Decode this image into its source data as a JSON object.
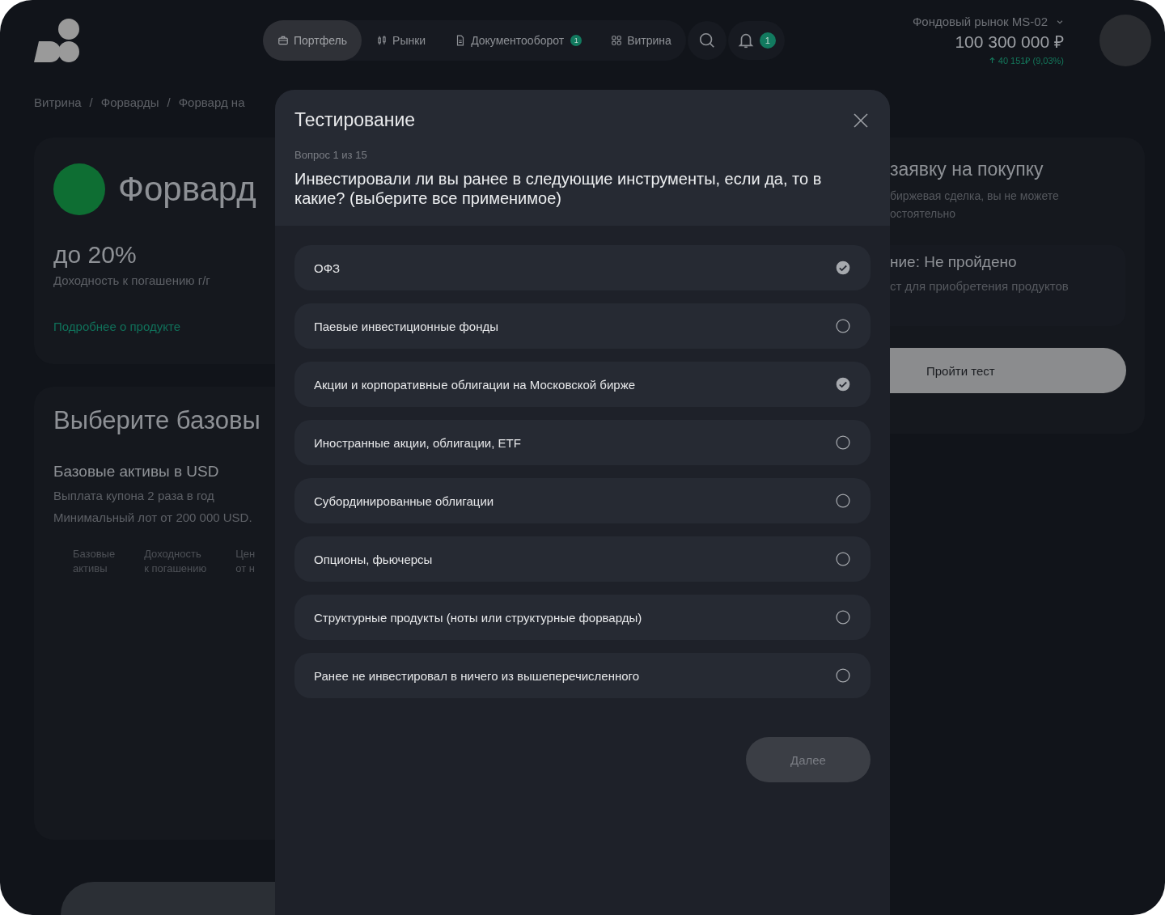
{
  "nav": {
    "tabs": [
      {
        "label": "Портфель",
        "selected": true,
        "kind": "briefcase"
      },
      {
        "label": "Рынки",
        "selected": false,
        "kind": "candles"
      },
      {
        "label": "Документооборот",
        "selected": false,
        "kind": "document",
        "badge": "1"
      },
      {
        "label": "Витрина",
        "selected": false,
        "kind": "grid"
      }
    ],
    "notifications_badge": "1"
  },
  "account": {
    "market": "Фондовый рынок MS-02",
    "balance": "100 300 000 ₽",
    "change": "40 151₽ (9,03%)"
  },
  "breadcrumbs": {
    "separator": "/",
    "items": [
      "Витрина",
      "Форварды",
      "Форвард на"
    ]
  },
  "product_card": {
    "title": "Форвард",
    "yield": "до 20%",
    "yield_label": "Доходность к погашению г/г",
    "link": "Подробнее о продукте"
  },
  "assets_card": {
    "title": "Выберите базовы",
    "group_title": "Базовые активы в USD",
    "notes": [
      "Выплата купона 2 раза в год",
      "Минимальный лот от 200 000 USD."
    ],
    "columns": [
      [
        "Базовые",
        "активы"
      ],
      [
        "Доходность",
        "к погашению"
      ],
      [
        "Цен",
        "от н"
      ]
    ]
  },
  "order_card": {
    "title": "заявку на покупку",
    "text_lines": [
      "биржевая сделка, вы не можете",
      "остоятельно"
    ],
    "status_title": "ние: Не пройдено",
    "status_text": "ст для приобретения продуктов",
    "button": "Пройти тест"
  },
  "quiz": {
    "title": "Тестирование",
    "progress": "Вопрос 1 из 15",
    "question": "Инвестировали ли вы ранее в следующие инструменты, если да, то в какие? (выберите все применимое)",
    "options": [
      {
        "label": "ОФЗ",
        "checked": true
      },
      {
        "label": "Паевые инвестиционные фонды",
        "checked": false
      },
      {
        "label": "Акции и корпоративные облигации на Московской бирже",
        "checked": true
      },
      {
        "label": "Иностранные акции, облигации, ETF",
        "checked": false
      },
      {
        "label": "Субординированные облигации",
        "checked": false
      },
      {
        "label": "Опционы, фьючерсы",
        "checked": false
      },
      {
        "label": "Структурные продукты (ноты или структурные форварды)",
        "checked": false
      },
      {
        "label": "Ранее не инвестировал в ничего из вышеперечисленного",
        "checked": false
      }
    ],
    "next_button": {
      "label": "Далее",
      "disabled": true
    }
  }
}
